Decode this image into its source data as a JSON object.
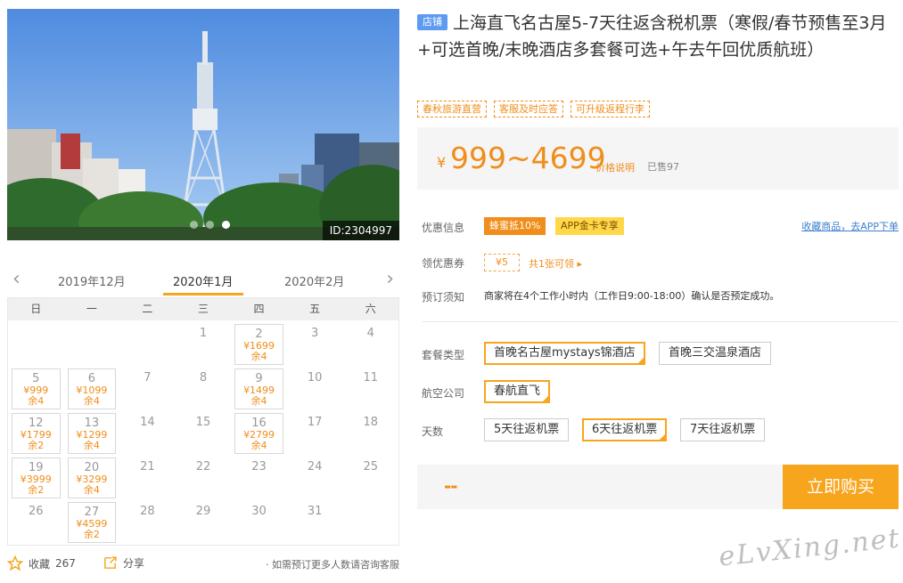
{
  "hero": {
    "image_id": "ID:2304997",
    "slides": 3,
    "active_slide": 3
  },
  "calendar": {
    "prev_month": "2019年12月",
    "current_month": "2020年1月",
    "next_month": "2020年2月",
    "weekdays": [
      "日",
      "一",
      "二",
      "三",
      "四",
      "五",
      "六"
    ],
    "weeks": [
      [
        {
          "day": ""
        },
        {
          "day": ""
        },
        {
          "day": ""
        },
        {
          "day": "1"
        },
        {
          "day": "2",
          "price": "¥1699",
          "stock": "余4"
        },
        {
          "day": "3"
        },
        {
          "day": "4"
        }
      ],
      [
        {
          "day": "5",
          "price": "¥999",
          "stock": "余4"
        },
        {
          "day": "6",
          "price": "¥1099",
          "stock": "余4"
        },
        {
          "day": "7"
        },
        {
          "day": "8"
        },
        {
          "day": "9",
          "price": "¥1499",
          "stock": "余4"
        },
        {
          "day": "10"
        },
        {
          "day": "11"
        }
      ],
      [
        {
          "day": "12",
          "price": "¥1799",
          "stock": "余2"
        },
        {
          "day": "13",
          "price": "¥1299",
          "stock": "余4"
        },
        {
          "day": "14"
        },
        {
          "day": "15"
        },
        {
          "day": "16",
          "price": "¥2799",
          "stock": "余4"
        },
        {
          "day": "17"
        },
        {
          "day": "18"
        }
      ],
      [
        {
          "day": "19",
          "price": "¥3999",
          "stock": "余2"
        },
        {
          "day": "20",
          "price": "¥3299",
          "stock": "余4"
        },
        {
          "day": "21"
        },
        {
          "day": "22"
        },
        {
          "day": "23"
        },
        {
          "day": "24"
        },
        {
          "day": "25"
        }
      ],
      [
        {
          "day": "26"
        },
        {
          "day": "27",
          "price": "¥4599",
          "stock": "余2"
        },
        {
          "day": "28"
        },
        {
          "day": "29"
        },
        {
          "day": "30"
        },
        {
          "day": "31"
        },
        {
          "day": ""
        }
      ]
    ]
  },
  "footer": {
    "favorite_label": "收藏",
    "favorite_count": "267",
    "share_label": "分享",
    "note": "· 如需预订更多人数请咨询客服"
  },
  "product": {
    "shop_tag": "店铺",
    "title": "上海直飞名古屋5-7天往返含税机票（寒假/春节预售至3月+可选首晚/末晚酒店多套餐可选+午去午回优质航班）",
    "chips": [
      "春秋旅游直营",
      "客服及时应答",
      "可升级返程行李"
    ],
    "price_currency": "¥",
    "price_range": "999~4699",
    "price_explain": "价格说明",
    "sold": "已售97"
  },
  "promo": {
    "label": "优惠信息",
    "badge1": "蜂蜜抵10%",
    "badge2": "APP金卡专享",
    "app_link": "收藏商品，去APP下单"
  },
  "coupon": {
    "label": "领优惠券",
    "value": "¥5",
    "text": "共1张可领 ▸"
  },
  "booking": {
    "label": "预订须知",
    "text": "商家将在4个工作小时内（工作日9:00-18:00）确认是否预定成功。"
  },
  "package": {
    "label": "套餐类型",
    "options": [
      "首晚名古屋mystays锦酒店",
      "首晚三交温泉酒店"
    ],
    "selected": 0
  },
  "airline": {
    "label": "航空公司",
    "options": [
      "春航直飞"
    ],
    "selected": 0
  },
  "days": {
    "label": "天数",
    "options": [
      "5天往返机票",
      "6天往返机票",
      "7天往返机票"
    ],
    "selected": 1
  },
  "buy": {
    "price_placeholder": "--",
    "button": "立即购买"
  },
  "watermark": "eLvXing.net",
  "colors": {
    "accent": "#f7a51c",
    "price": "#f08d1b",
    "tag_blue": "#5d9af2",
    "link": "#3e7fce"
  }
}
